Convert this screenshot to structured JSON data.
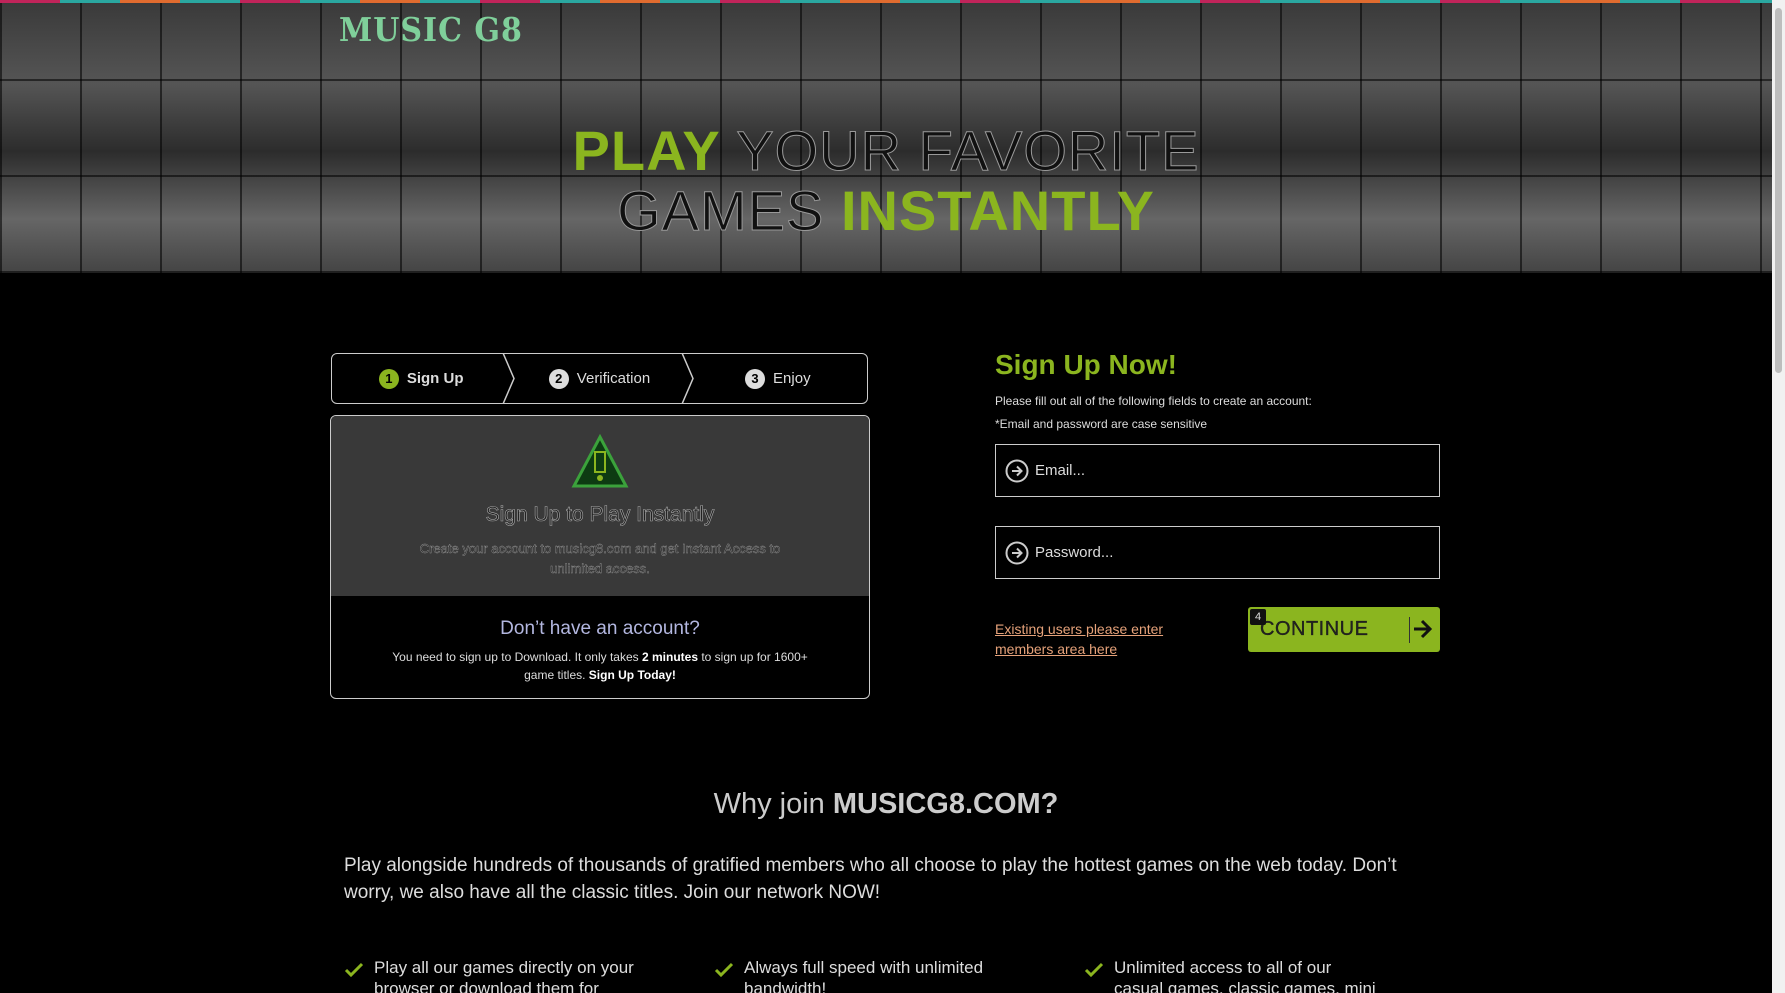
{
  "brand": {
    "logo_text": "MUSIC G8"
  },
  "hero": {
    "headline_word1": "PLAY",
    "headline_word2": "YOUR FAVORITE",
    "headline_word3": "GAMES",
    "headline_word4": "INSTANTLY"
  },
  "steps": [
    {
      "num": "1",
      "label": "Sign Up"
    },
    {
      "num": "2",
      "label": "Verification"
    },
    {
      "num": "3",
      "label": "Enjoy"
    }
  ],
  "infobox": {
    "title": "Sign Up to Play Instantly",
    "description": "Create your account to musicg8.com and get Instant Access to unlimited access.",
    "lower_title": "Don’t have an account?",
    "lower_text_1": "You need to sign up to Download. It only takes ",
    "lower_bold_1": "2 minutes",
    "lower_text_2": " to sign up for 1600+ game titles. ",
    "lower_bold_2": "Sign Up Today!"
  },
  "signup": {
    "title": "Sign Up Now!",
    "description": "Please fill out all of the following fields to create an account:",
    "note": "*Email and password are case sensitive",
    "email_placeholder": "Email...",
    "password_placeholder": "Password...",
    "existing_link": "Existing users please enter members area here",
    "continue_label": "CONTINUE",
    "continue_badge": "4"
  },
  "why": {
    "title_prefix": "Why join ",
    "title_brand": "MUSICG8.COM?",
    "text": "Play alongside hundreds of thousands of gratified members who all choose to play the hottest games on the web today. Don’t worry, we also have all the classic titles. Join our network NOW!",
    "features": [
      "Play all our games directly on your browser or download them for offline",
      "Always full speed with unlimited bandwidth!",
      "Unlimited access to all of our casual games, classic games, mini games and"
    ]
  },
  "colors": {
    "accent_green": "#8bb51f",
    "link_orange": "#e6a27a",
    "heading_lavender": "#b3b7e0"
  }
}
